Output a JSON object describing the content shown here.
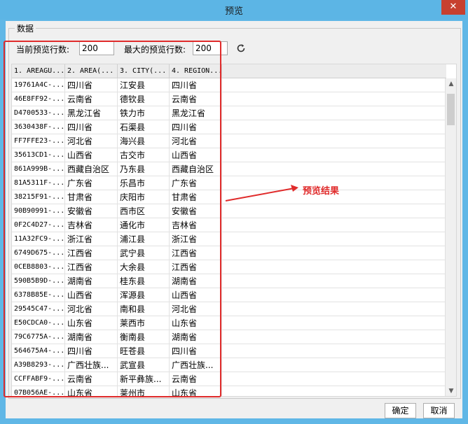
{
  "window": {
    "title": "预览",
    "close_glyph": "✕"
  },
  "group": {
    "legend": "数据"
  },
  "controls": {
    "current_label": "当前预览行数:",
    "current_value": "200",
    "max_label": "最大的预览行数:",
    "max_value": "200"
  },
  "table": {
    "headers": [
      "1. AREAGU...",
      "2. AREA(...",
      "3. CITY(...",
      "4. REGION..."
    ],
    "rows": [
      [
        "19761A4C-...",
        "四川省",
        "江安县",
        "四川省"
      ],
      [
        "46E8FF92-...",
        "云南省",
        "德钦县",
        "云南省"
      ],
      [
        "D4700533-...",
        "黑龙江省",
        "铁力市",
        "黑龙江省"
      ],
      [
        "3630438F-...",
        "四川省",
        "石渠县",
        "四川省"
      ],
      [
        "FF7FFE23-...",
        "河北省",
        "海兴县",
        "河北省"
      ],
      [
        "35613CD1-...",
        "山西省",
        "古交市",
        "山西省"
      ],
      [
        "861A999B-...",
        "西藏自治区",
        "乃东县",
        "西藏自治区"
      ],
      [
        "81A5311F-...",
        "广东省",
        "乐昌市",
        "广东省"
      ],
      [
        "38215F91-...",
        "甘肃省",
        "庆阳市",
        "甘肃省"
      ],
      [
        "90B90991-...",
        "安徽省",
        "西市区",
        "安徽省"
      ],
      [
        "0F2C4D27-...",
        "吉林省",
        "通化市",
        "吉林省"
      ],
      [
        "11A32FC9-...",
        "浙江省",
        "浦江县",
        "浙江省"
      ],
      [
        "6749D675-...",
        "江西省",
        "武宁县",
        "江西省"
      ],
      [
        "0CEB8803-...",
        "江西省",
        "大余县",
        "江西省"
      ],
      [
        "590B5B9D-...",
        "湖南省",
        "桂东县",
        "湖南省"
      ],
      [
        "6378B85E-...",
        "山西省",
        "浑源县",
        "山西省"
      ],
      [
        "29545C47-...",
        "河北省",
        "南和县",
        "河北省"
      ],
      [
        "E50CDCA0-...",
        "山东省",
        "莱西市",
        "山东省"
      ],
      [
        "79C6775A-...",
        "湖南省",
        "衡南县",
        "湖南省"
      ],
      [
        "564675A4-...",
        "四川省",
        "旺苍县",
        "四川省"
      ],
      [
        "A39B8293-...",
        "广西壮族...",
        "武宣县",
        "广西壮族..."
      ],
      [
        "CCFFABF9-...",
        "云南省",
        "新平彝族...",
        "云南省"
      ],
      [
        "07B056AE-...",
        "山东省",
        "莱州市",
        "山东省"
      ]
    ]
  },
  "annotation": {
    "label": "预览结果",
    "color": "#e02b2b"
  },
  "buttons": {
    "ok": "确定",
    "cancel": "取消"
  }
}
